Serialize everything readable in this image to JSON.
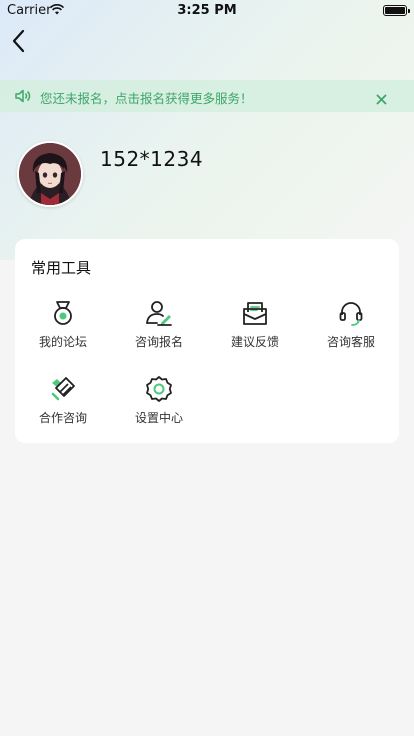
{
  "status": {
    "carrier": "Carrier",
    "time": "3:25 PM"
  },
  "notice": {
    "text": "您还未报名，点击报名获得更多服务！"
  },
  "user": {
    "name": "152*1234"
  },
  "tools": {
    "title": "常用工具",
    "items": [
      {
        "label": "我的论坛",
        "icon": "medal-icon"
      },
      {
        "label": "咨询报名",
        "icon": "user-edit-icon"
      },
      {
        "label": "建议反馈",
        "icon": "mail-icon"
      },
      {
        "label": "咨询客服",
        "icon": "headset-icon"
      },
      {
        "label": "合作咨询",
        "icon": "handshake-icon"
      },
      {
        "label": "设置中心",
        "icon": "gear-icon"
      }
    ]
  },
  "colors": {
    "accent": "#3ea56a",
    "accent_light": "#4cc97a",
    "icon_dark": "#222222"
  }
}
